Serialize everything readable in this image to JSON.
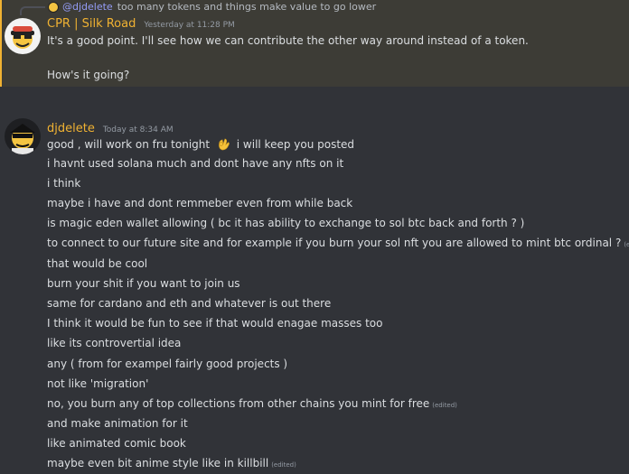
{
  "reply": {
    "mention": "@djdelete",
    "text": "too many tokens and things make value to go lower"
  },
  "messages": [
    {
      "author": "CPR | Silk Road",
      "timestamp": "Yesterday at 11:28 PM",
      "lines": [
        "It's a good point. I'll see how we can contribute the other way around instead of a token.",
        "How's it going?"
      ]
    },
    {
      "author": "djdelete",
      "timestamp": "Today at 8:34 AM",
      "first_line": {
        "before_emoji": "good , will work on fru tonight",
        "after_emoji": "i will keep you posted",
        "emoji": "ok-hand-emoji"
      },
      "lines": [
        "i havnt used solana much and dont have any nfts on it",
        "i think",
        "maybe i have and dont remmeber even from while back",
        "is magic eden wallet allowing ( bc it has ability to exchange to sol btc back and forth ? )",
        "to connect to our future site and for example if you burn your sol nft you are allowed to mint btc ordinal ?",
        "that would be cool",
        "burn your shit if you want to join us",
        "same for cardano and eth and whatever is out there",
        "I think it would be fun to see if that would enagae masses too",
        "like its controvertial idea",
        "any ( from for exampel fairly good projects )",
        "not like 'migration'",
        "no, you burn any of top collections from other chains you mint for free",
        "and make animation for it",
        "like animated comic book",
        "maybe even bit anime style like in killbill"
      ],
      "edited_label": "(edited)"
    }
  ]
}
